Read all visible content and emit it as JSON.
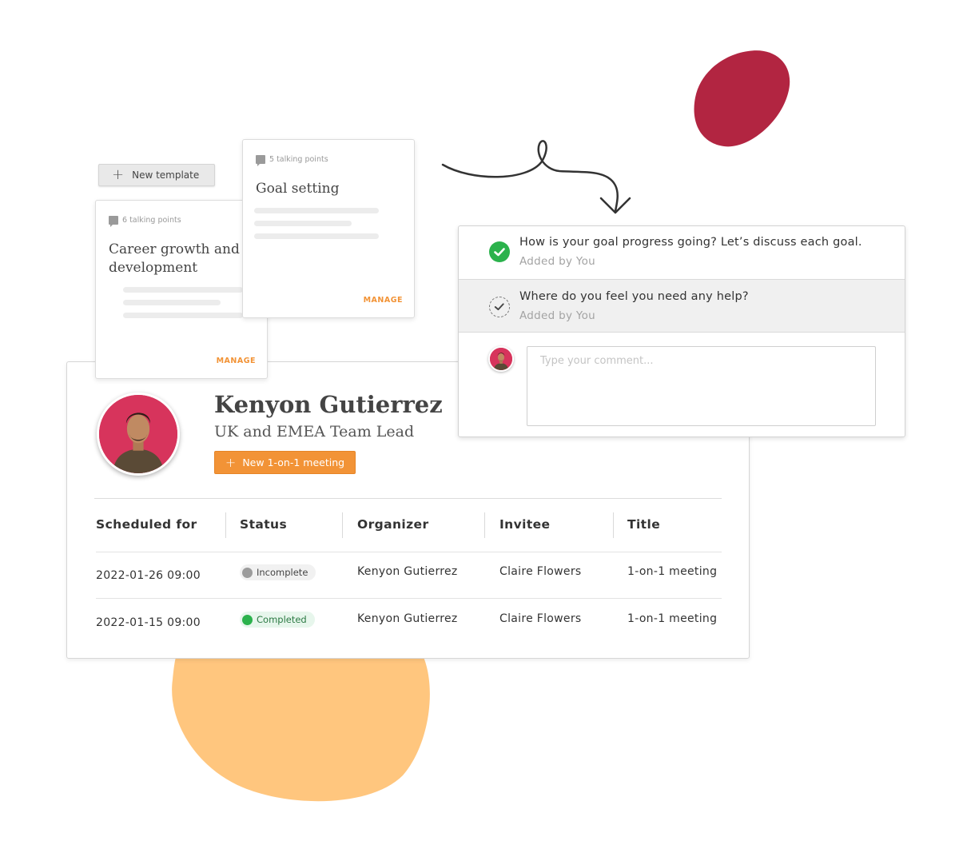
{
  "colors": {
    "accent_orange": "#f29336",
    "blob_red": "#b22541",
    "blob_orange": "#ffc67e",
    "status_complete": "#2bb24c",
    "status_incomplete": "#9b9b9b",
    "avatar_bg": "#d7345c"
  },
  "templates": {
    "new_template_label": "New template",
    "cards": [
      {
        "talking_points": "6 talking points",
        "title": "Career growth and development",
        "action": "MANAGE"
      },
      {
        "talking_points": "5 talking points",
        "title": "Goal setting",
        "action": "MANAGE"
      }
    ]
  },
  "profile": {
    "name": "Kenyon Gutierrez",
    "role": "UK and EMEA Team Lead",
    "new_meeting_label": "New 1-on-1 meeting"
  },
  "meetings": {
    "headers": [
      "Scheduled for",
      "Status",
      "Organizer",
      "Invitee",
      "Title"
    ],
    "rows": [
      {
        "scheduled": "2022-01-26 09:00",
        "status": "Incomplete",
        "organizer": "Kenyon Gutierrez",
        "invitee": "Claire Flowers",
        "title": "1-on-1 meeting"
      },
      {
        "scheduled": "2022-01-15 09:00",
        "status": "Completed",
        "organizer": "Kenyon Gutierrez",
        "invitee": "Claire Flowers",
        "title": "1-on-1 meeting"
      }
    ]
  },
  "talking_points": {
    "items": [
      {
        "question": "How is your goal progress going? Let’s discuss each goal.",
        "added_by": "Added by You",
        "state": "completed"
      },
      {
        "question": "Where do you feel you need any help?",
        "added_by": "Added by You",
        "state": "pending"
      }
    ],
    "comment_placeholder": "Type your comment..."
  }
}
